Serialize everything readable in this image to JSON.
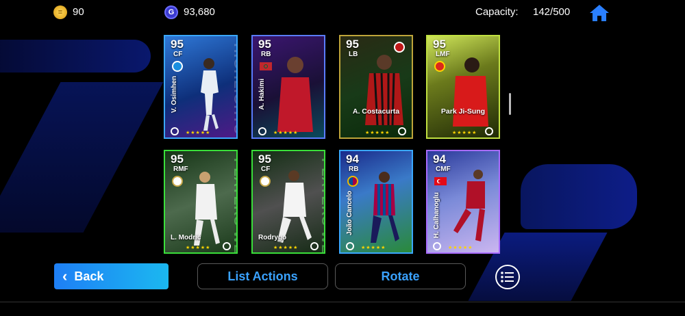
{
  "header": {
    "gold_coins": "90",
    "gp": "93,680",
    "capacity_label": "Capacity:",
    "capacity_value": "142/500"
  },
  "cards": [
    {
      "rating": "95",
      "position": "CF",
      "name": "V. Osimhen",
      "deco": "HIGHLIGHTS"
    },
    {
      "rating": "95",
      "position": "RB",
      "name": "A. Hakimi"
    },
    {
      "rating": "95",
      "position": "LB",
      "name": "A. Costacurta"
    },
    {
      "rating": "95",
      "position": "LMF",
      "name": "Park Ji-Sung"
    },
    {
      "rating": "95",
      "position": "RMF",
      "name": "L. Modrić",
      "deco": "PLAYERS WEEK"
    },
    {
      "rating": "95",
      "position": "CF",
      "name": "Rodrygo",
      "deco": "PLAYERS WEEK"
    },
    {
      "rating": "94",
      "position": "RB",
      "name": "João Cancelo"
    },
    {
      "rating": "94",
      "position": "CMF",
      "name": "H. Calhanoglu"
    }
  ],
  "stars": "★★★★★",
  "buttons": {
    "back": "Back",
    "list_actions": "List Actions",
    "rotate": "Rotate"
  },
  "icons": {
    "gold_coin": "coin-icon",
    "gp": "gp-icon",
    "home": "home-icon",
    "menu": "list-menu-icon",
    "back": "chevron-left-icon"
  },
  "colors": {
    "accent_blue": "#1e7ff5",
    "button_text": "#3aa2ff",
    "star": "#ffd400"
  }
}
